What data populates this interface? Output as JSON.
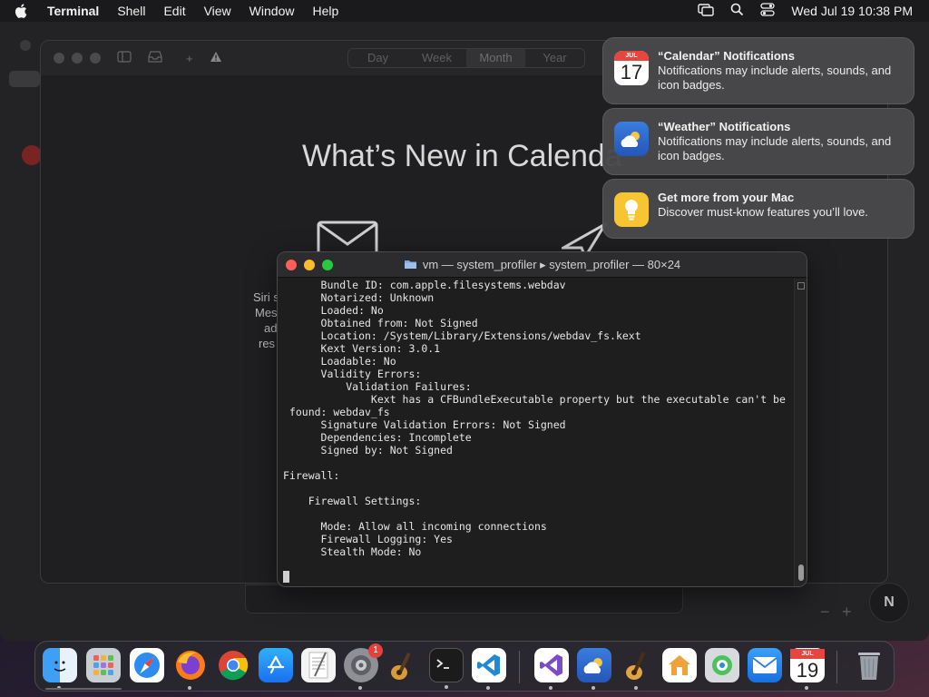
{
  "menubar": {
    "app_name": "Terminal",
    "items": [
      "Shell",
      "Edit",
      "View",
      "Window",
      "Help"
    ],
    "clock": "Wed Jul 19  10:38 PM"
  },
  "calendar_window": {
    "segments": [
      "Day",
      "Week",
      "Month",
      "Year"
    ],
    "active_segment": "Month",
    "heading": "What’s New in Calenda",
    "side_text": [
      "Siri s",
      "Mes",
      "ad",
      "res"
    ]
  },
  "terminal": {
    "title": "vm — system_profiler ▸ system_profiler — 80×24",
    "lines": [
      "      Bundle ID: com.apple.filesystems.webdav",
      "      Notarized: Unknown",
      "      Loaded: No",
      "      Obtained from: Not Signed",
      "      Location: /System/Library/Extensions/webdav_fs.kext",
      "      Kext Version: 3.0.1",
      "      Loadable: No",
      "      Validity Errors:",
      "          Validation Failures:",
      "              Kext has a CFBundleExecutable property but the executable can't be",
      " found: webdav_fs",
      "      Signature Validation Errors: Not Signed",
      "      Dependencies: Incomplete",
      "      Signed by: Not Signed",
      "",
      "Firewall:",
      "",
      "    Firewall Settings:",
      "",
      "      Mode: Allow all incoming connections",
      "      Firewall Logging: Yes",
      "      Stealth Mode: No"
    ]
  },
  "notifications": [
    {
      "title": "“Calendar” Notifications",
      "body": "Notifications may include alerts, sounds, and icon badges.",
      "icon": "calendar-icon",
      "icon_month": "JUL",
      "icon_day": "17"
    },
    {
      "title": "“Weather” Notifications",
      "body": "Notifications may include alerts, sounds, and icon badges.",
      "icon": "weather-icon"
    },
    {
      "title": "Get more from your Mac",
      "body": "Discover must-know features you’ll love.",
      "icon": "tips-icon"
    }
  ],
  "desktop": {
    "compass_label": "N"
  },
  "dock": {
    "items": [
      {
        "name": "finder",
        "running": true
      },
      {
        "name": "launchpad",
        "running": false
      },
      {
        "name": "safari",
        "running": false
      },
      {
        "name": "firefox",
        "running": true
      },
      {
        "name": "chrome",
        "running": false
      },
      {
        "name": "app-store",
        "running": false
      },
      {
        "name": "textedit",
        "running": false
      },
      {
        "name": "system-preferences",
        "running": true,
        "badge": "1"
      },
      {
        "name": "instruments",
        "running": false
      },
      {
        "name": "terminal",
        "running": true
      },
      {
        "name": "vscode",
        "running": true
      },
      {
        "name": "visual-studio",
        "running": true
      },
      {
        "name": "weather",
        "running": true
      },
      {
        "name": "garageband",
        "running": true
      },
      {
        "name": "home",
        "running": false
      },
      {
        "name": "find-my",
        "running": false
      },
      {
        "name": "mail",
        "running": false
      },
      {
        "name": "calendar",
        "running": true,
        "month": "JUL",
        "day": "19"
      },
      {
        "name": "trash",
        "running": false
      }
    ]
  },
  "colors": {
    "close": "#fe5f57",
    "minimize": "#febc2e",
    "zoom": "#28c840",
    "badge": "#e5403a"
  }
}
